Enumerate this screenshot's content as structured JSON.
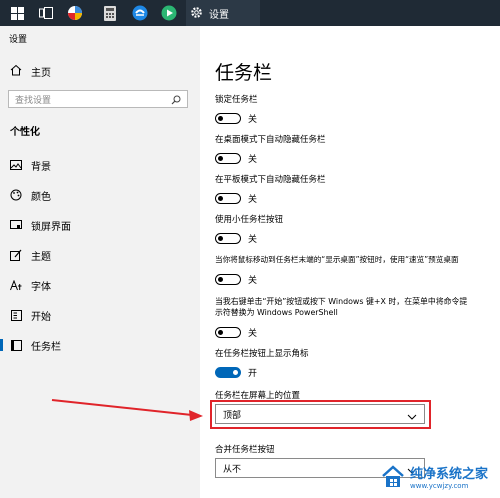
{
  "taskbar": {
    "settings_label": "设置"
  },
  "window": {
    "title": "设置"
  },
  "sidebar": {
    "home_label": "主页",
    "search_placeholder": "查找设置",
    "section_title": "个性化",
    "items": [
      {
        "label": "背景",
        "icon": "picture-icon"
      },
      {
        "label": "颜色",
        "icon": "palette-icon"
      },
      {
        "label": "锁屏界面",
        "icon": "lock-screen-icon"
      },
      {
        "label": "主题",
        "icon": "theme-icon"
      },
      {
        "label": "字体",
        "icon": "font-icon"
      },
      {
        "label": "开始",
        "icon": "start-icon"
      },
      {
        "label": "任务栏",
        "icon": "taskbar-icon",
        "active": true
      }
    ]
  },
  "main": {
    "title": "任务栏",
    "settings": [
      {
        "label": "锁定任务栏",
        "state": "关",
        "on": false
      },
      {
        "label": "在桌面模式下自动隐藏任务栏",
        "state": "关",
        "on": false
      },
      {
        "label": "在平板模式下自动隐藏任务栏",
        "state": "关",
        "on": false
      },
      {
        "label": "使用小任务栏按钮",
        "state": "关",
        "on": false
      },
      {
        "label": "当你将鼠标移动到任务栏末端的“显示桌面”按钮时，使用“速览”预览桌面",
        "state": "关",
        "on": false
      },
      {
        "label_line1": "当我右键单击“开始”按钮或按下 Windows 键+X 时，在菜单中将命令提",
        "label_line2": "示符替换为 Windows PowerShell",
        "state": "关",
        "on": false
      },
      {
        "label": "在任务栏按钮上显示角标",
        "state": "开",
        "on": true
      }
    ],
    "position": {
      "label": "任务栏在屏幕上的位置",
      "value": "顶部"
    },
    "combine": {
      "label": "合并任务栏按钮",
      "value": "从不"
    }
  },
  "watermark": {
    "title": "纯净系统之家",
    "url": "www.ycwjzy.com"
  },
  "colors": {
    "accent": "#0067b8",
    "taskbar": "#1f2a35",
    "sidebar": "#f2f2f2",
    "annotation_red": "#e0242a"
  }
}
